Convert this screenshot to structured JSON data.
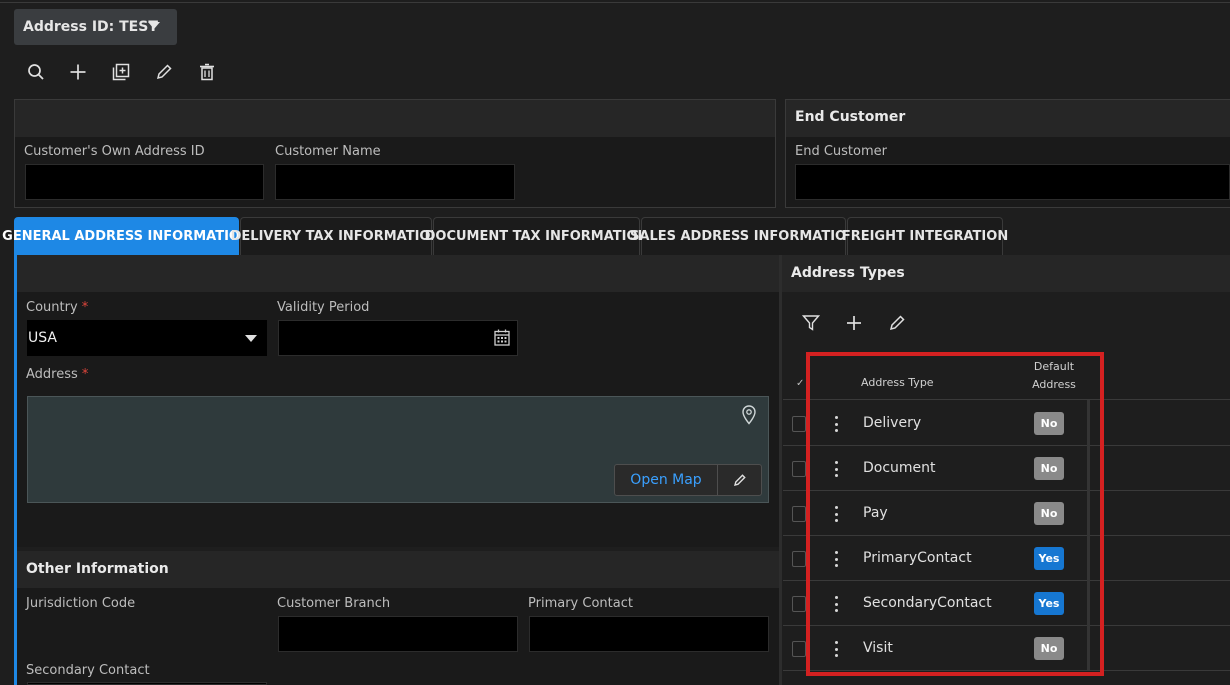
{
  "header": {
    "address_id_label": "Address ID: TEST"
  },
  "toolbar": {
    "icons": [
      "search-icon",
      "plus-icon",
      "duplicate-icon",
      "pencil-icon",
      "trash-icon"
    ]
  },
  "customer_panel": {
    "own_address_id_label": "Customer's Own Address ID",
    "own_address_id_value": "",
    "customer_name_label": "Customer Name",
    "customer_name_value": ""
  },
  "end_customer_panel": {
    "title": "End Customer",
    "field_label": "End Customer",
    "field_value": ""
  },
  "tabs": [
    {
      "label": "GENERAL ADDRESS INFORMATION",
      "active": true
    },
    {
      "label": "DELIVERY TAX INFORMATION",
      "active": false
    },
    {
      "label": "DOCUMENT TAX INFORMATION",
      "active": false
    },
    {
      "label": "SALES ADDRESS INFORMATION",
      "active": false
    },
    {
      "label": "FREIGHT INTEGRATION",
      "active": false
    }
  ],
  "general": {
    "country_label": "Country",
    "required_mark": "*",
    "country_value": "USA",
    "validity_label": "Validity Period",
    "validity_value": "",
    "address_label": "Address",
    "open_map_label": "Open Map"
  },
  "other_info": {
    "title": "Other Information",
    "jurisdiction_label": "Jurisdiction Code",
    "customer_branch_label": "Customer Branch",
    "primary_contact_label": "Primary Contact",
    "secondary_contact_label": "Secondary Contact"
  },
  "address_types": {
    "title": "Address Types",
    "select_all_mark": "✓",
    "col_type": "Address Type",
    "col_default_line1": "Default",
    "col_default_line2": "Address",
    "rows": [
      {
        "type": "Delivery",
        "default": "No"
      },
      {
        "type": "Document",
        "default": "No"
      },
      {
        "type": "Pay",
        "default": "No"
      },
      {
        "type": "PrimaryContact",
        "default": "Yes"
      },
      {
        "type": "SecondaryContact",
        "default": "Yes"
      },
      {
        "type": "Visit",
        "default": "No"
      }
    ]
  },
  "colors": {
    "accent": "#1e88e5",
    "yes_badge": "#1677d2",
    "no_badge": "#8a8a8a",
    "required": "#e0463c",
    "highlight": "#d42121",
    "link": "#3aa0ff"
  }
}
